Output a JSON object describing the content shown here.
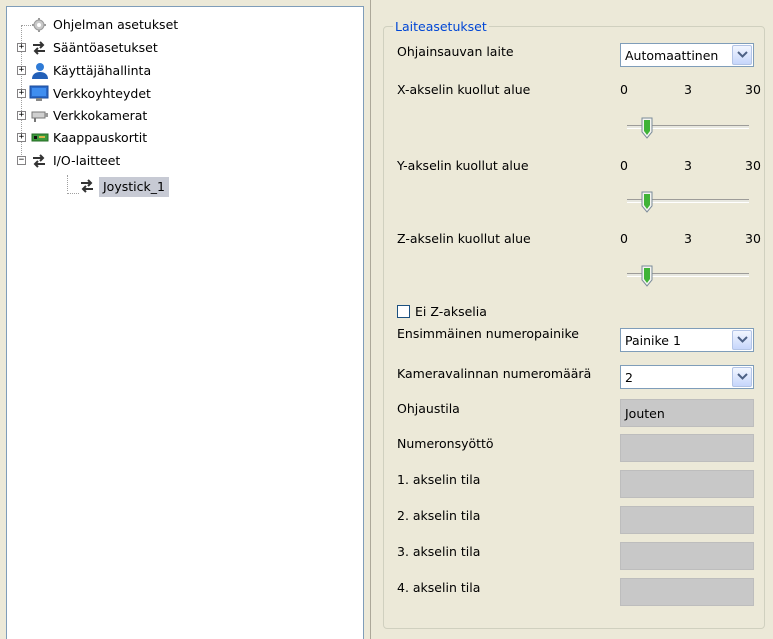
{
  "tree": {
    "items": [
      {
        "label": "Ohjelman asetukset",
        "icon": "gear-icon",
        "expander": ""
      },
      {
        "label": "Sääntöasetukset",
        "icon": "arrows-icon",
        "expander": "+"
      },
      {
        "label": "Käyttäjähallinta",
        "icon": "user-icon",
        "expander": "+"
      },
      {
        "label": "Verkkoyhteydet",
        "icon": "monitor-icon",
        "expander": "+"
      },
      {
        "label": "Verkkokamerat",
        "icon": "camera-icon",
        "expander": "+"
      },
      {
        "label": "Kaappauskortit",
        "icon": "card-icon",
        "expander": "+"
      },
      {
        "label": "I/O-laitteet",
        "icon": "arrows-icon",
        "expander": "−"
      },
      {
        "label": "Joystick_1",
        "icon": "arrows-icon",
        "expander": "",
        "selected": true
      }
    ]
  },
  "settings": {
    "group_title": "Laiteasetukset",
    "joystick_device": {
      "label": "Ohjainsauvan laite",
      "value": "Automaattinen"
    },
    "x_deadzone": {
      "label": "X-akselin kuollut alue",
      "min": "0",
      "current": "3",
      "max": "30",
      "value": 3
    },
    "y_deadzone": {
      "label": "Y-akselin kuollut alue",
      "min": "0",
      "current": "3",
      "max": "30",
      "value": 3
    },
    "z_deadzone": {
      "label": "Z-akselin kuollut alue",
      "min": "0",
      "current": "3",
      "max": "30",
      "value": 3
    },
    "no_z_axis": {
      "label": "Ei Z-akselia",
      "checked": false
    },
    "first_number_button": {
      "label": "Ensimmäinen numeropainike",
      "value": "Painike 1"
    },
    "camera_number_count": {
      "label": "Kameravalinnan numeromäärä",
      "value": "2"
    },
    "control_mode": {
      "label": "Ohjaustila",
      "value": "Jouten"
    },
    "number_input": {
      "label": "Numeronsyöttö",
      "value": ""
    },
    "axis1": {
      "label": "1. akselin tila",
      "value": ""
    },
    "axis2": {
      "label": "2. akselin tila",
      "value": ""
    },
    "axis3": {
      "label": "3. akselin tila",
      "value": ""
    },
    "axis4": {
      "label": "4. akselin tila",
      "value": ""
    }
  },
  "colors": {
    "group_title": "#0046d5",
    "thumb_green": "#3fb337",
    "selection": "#c7cad4"
  }
}
